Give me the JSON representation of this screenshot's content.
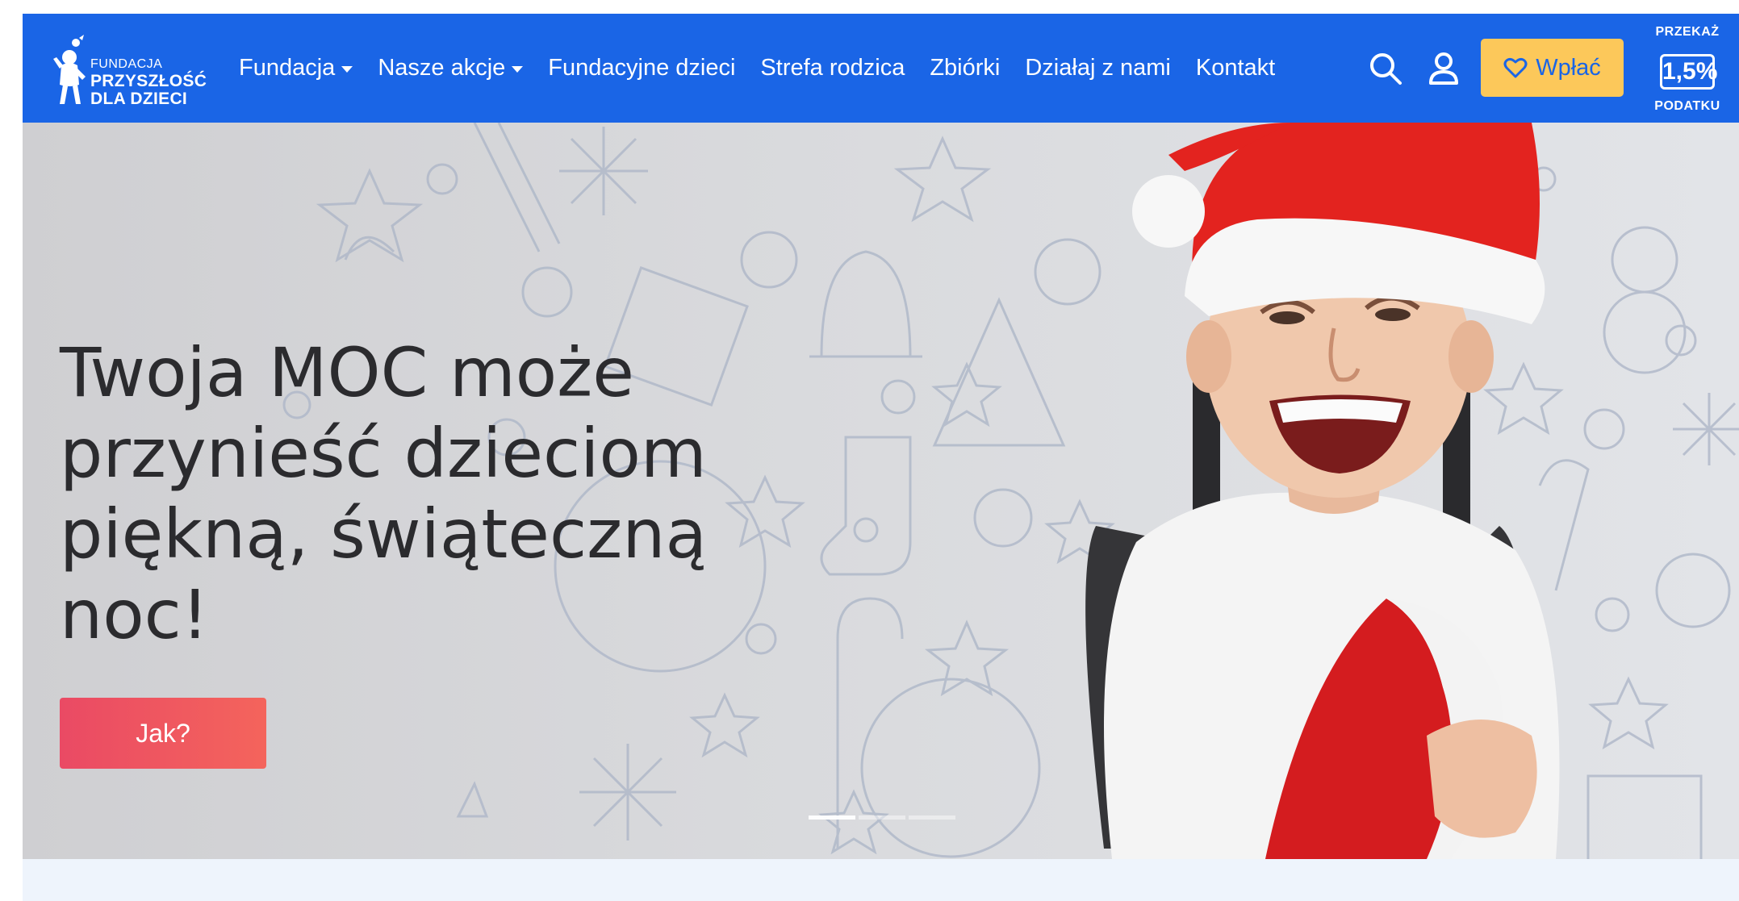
{
  "logo": {
    "line1": "FUNDACJA",
    "line2": "PRZYSZŁOŚĆ",
    "line3": "DLA DZIECI"
  },
  "nav": {
    "items": [
      {
        "label": "Fundacja",
        "dropdown": true
      },
      {
        "label": "Nasze akcje",
        "dropdown": true
      },
      {
        "label": "Fundacyjne dzieci",
        "dropdown": false
      },
      {
        "label": "Strefa rodzica",
        "dropdown": false
      },
      {
        "label": "Zbiórki",
        "dropdown": false
      },
      {
        "label": "Działaj z nami",
        "dropdown": false
      },
      {
        "label": "Kontakt",
        "dropdown": false
      }
    ],
    "search_icon": "search-icon",
    "user_icon": "user-icon",
    "donate_label": "Wpłać",
    "donate_icon": "heart-icon",
    "tax": {
      "top": "PRZEKAŻ",
      "value": "1,5%",
      "bottom": "PODATKU"
    }
  },
  "hero": {
    "headline": "Twoja MOC może przynieść dzieciom piękną, świąteczną noc!",
    "cta_label": "Jak?",
    "slides": 3,
    "active_slide": 1
  },
  "colors": {
    "navbar": "#1a65e6",
    "donate_button": "#fcc85a",
    "cta": "#ee5260",
    "headline": "#2b2b2e"
  }
}
